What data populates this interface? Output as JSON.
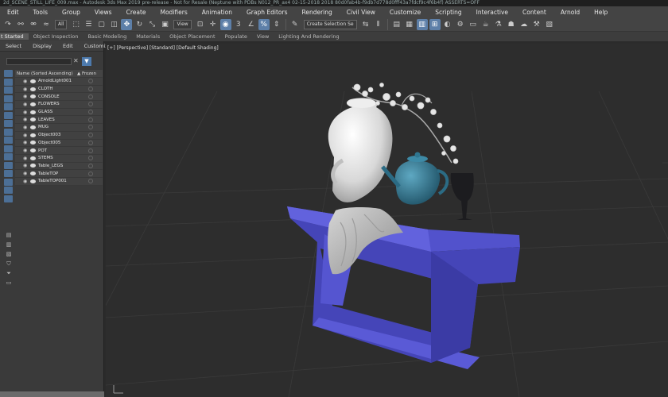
{
  "window": {
    "title": "2d_SCENE_STILL_LIFE_009.max - Autodesk 3ds Max 2019 pre-release - Not for Resale (Neptune with PDBs N012_PR_ax4 02-15-2018 2018 80d0fab4b-f9db7d778d0fff43a7fdcf9c4f6b4f) ASSERTS=OFF"
  },
  "menu": [
    "Edit",
    "Tools",
    "Group",
    "Views",
    "Create",
    "Modifiers",
    "Animation",
    "Graph Editors",
    "Rendering",
    "Civil View",
    "Customize",
    "Scripting",
    "Interactive",
    "Content",
    "Arnold",
    "Help"
  ],
  "toolbar": {
    "selection_filter": "All",
    "reference_coord": "View",
    "named_selection": "Create Selection Se"
  },
  "ribbon": [
    "t Started",
    "Object Inspection",
    "Basic Modeling",
    "Materials",
    "Object Placement",
    "Populate",
    "View",
    "Lighting And Rendering"
  ],
  "scene_explorer": {
    "tabs": [
      "Select",
      "Display",
      "Edit",
      "Customize"
    ],
    "column_name": "Name (Sorted Ascending)",
    "column_frozen": "▲ Frozen",
    "objects": [
      "ArnoldLight001",
      "CLOTH",
      "CONSOLE",
      "FLOWERS",
      "GLASS",
      "LEAVES",
      "MUG",
      "Object003",
      "Object005",
      "POT",
      "STEMS",
      "Table_LEGS",
      "TableTOP",
      "TableTOP001"
    ]
  },
  "viewport": {
    "label": "[+] [Perspective] [Standard] [Default Shading]"
  },
  "colors": {
    "table": "#5151c8",
    "teapot": "#2f6f86",
    "ui_accent": "#5d7fa8"
  }
}
